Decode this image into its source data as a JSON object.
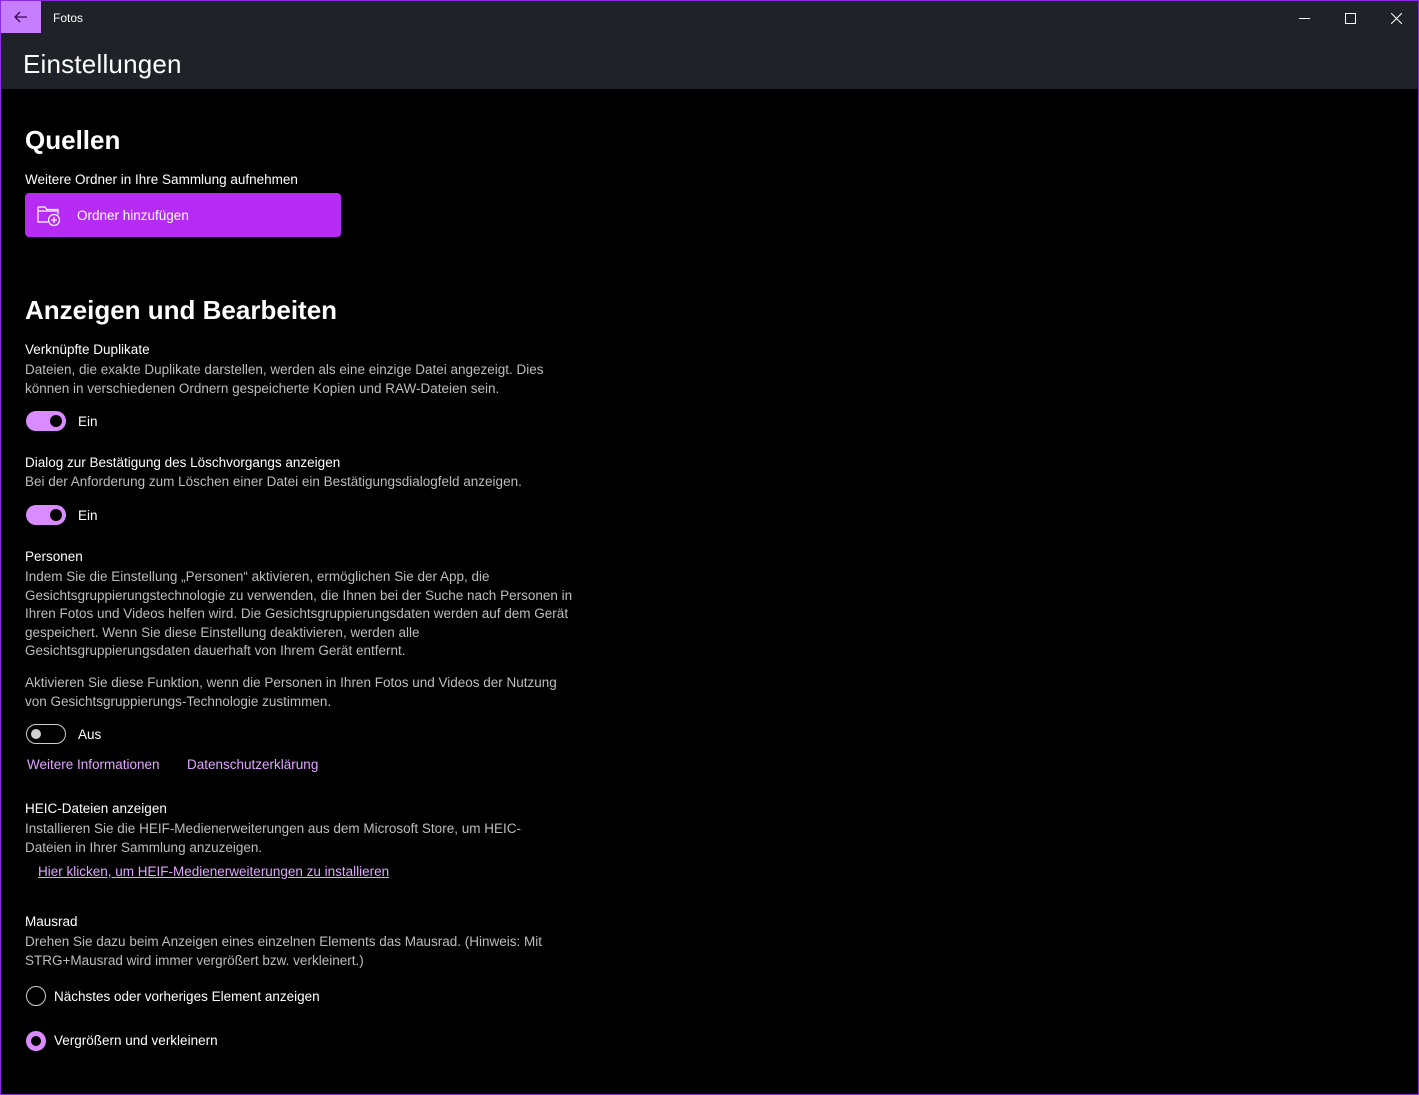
{
  "window": {
    "app_title": "Fotos"
  },
  "header": {
    "page_title": "Einstellungen"
  },
  "sources": {
    "heading": "Quellen",
    "subtitle": "Weitere Ordner in Ihre Sammlung aufnehmen",
    "add_folder_label": "Ordner hinzufügen"
  },
  "view_edit": {
    "heading": "Anzeigen und Bearbeiten",
    "duplicates": {
      "title": "Verknüpfte Duplikate",
      "desc": "Dateien, die exakte Duplikate darstellen, werden als eine einzige Datei angezeigt. Dies können in verschiedenen Ordnern gespeicherte Kopien und RAW-Dateien sein.",
      "state": "Ein"
    },
    "delete_confirm": {
      "title": "Dialog zur Bestätigung des Löschvorgangs anzeigen",
      "desc": "Bei der Anforderung zum Löschen einer Datei ein Bestätigungsdialogfeld anzeigen.",
      "state": "Ein"
    },
    "people": {
      "title": "Personen",
      "desc1": "Indem Sie die Einstellung „Personen“ aktivieren, ermöglichen Sie der App, die Gesichtsgruppierungstechnologie zu verwenden, die Ihnen bei der Suche nach Personen in Ihren Fotos und Videos helfen wird. Die Gesichtsgruppierungsdaten werden auf dem Gerät gespeichert. Wenn Sie diese Einstellung deaktivieren, werden alle Gesichtsgruppierungsdaten dauerhaft von Ihrem Gerät entfernt.",
      "desc2": "Aktivieren Sie diese Funktion, wenn die Personen in Ihren Fotos und Videos der Nutzung von Gesichtsgruppierungs-Technologie zustimmen.",
      "state": "Aus",
      "link_more": "Weitere Informationen",
      "link_privacy": "Datenschutzerklärung"
    },
    "heic": {
      "title": "HEIC-Dateien anzeigen",
      "desc": "Installieren Sie die HEIF-Medienerweiterungen aus dem Microsoft Store, um HEIC-Dateien in Ihrer Sammlung anzuzeigen.",
      "link": "Hier klicken, um HEIF-Medienerweiterungen zu installieren"
    },
    "mouse_wheel": {
      "title": "Mausrad",
      "desc": "Drehen Sie dazu beim Anzeigen eines einzelnen Elements das Mausrad. (Hinweis: Mit STRG+Mausrad wird immer vergrößert bzw. verkleinert.)",
      "option_next_prev": "Nächstes oder vorheriges Element anzeigen",
      "option_zoom": "Vergrößern und verkleinern",
      "selected": "option_zoom"
    }
  },
  "colors": {
    "accent": "#b62cf5",
    "accent_light": "#d98bff",
    "link": "#e0a6ff",
    "titlebar": "#1f2329"
  }
}
